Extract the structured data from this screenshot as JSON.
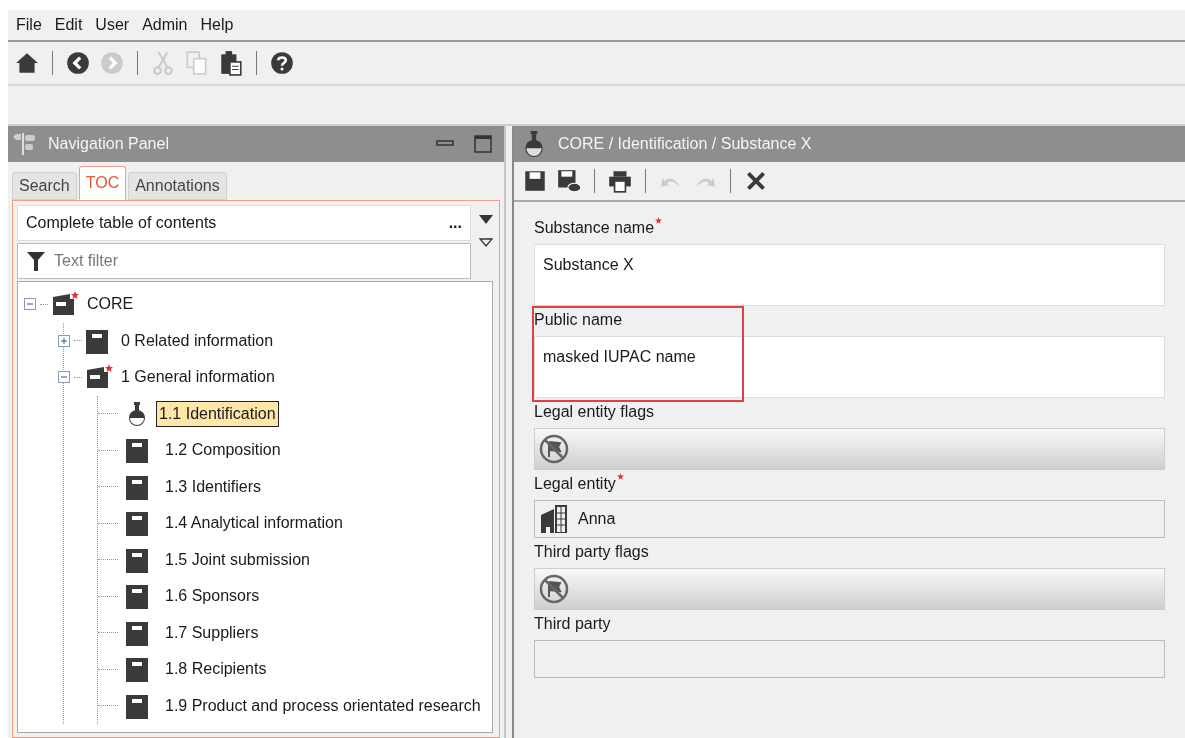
{
  "menu": [
    "File",
    "Edit",
    "User",
    "Admin",
    "Help"
  ],
  "toolbar": [
    {
      "kind": "home",
      "disabled": false
    },
    {
      "kind": "sep"
    },
    {
      "kind": "back",
      "disabled": false
    },
    {
      "kind": "forward",
      "disabled": true
    },
    {
      "kind": "sep"
    },
    {
      "kind": "cut",
      "disabled": true
    },
    {
      "kind": "copy",
      "disabled": true
    },
    {
      "kind": "paste",
      "disabled": false
    },
    {
      "kind": "sep"
    },
    {
      "kind": "help",
      "disabled": false
    }
  ],
  "navigation": {
    "title": "Navigation Panel",
    "tabs": [
      {
        "label": "Search",
        "selected": false
      },
      {
        "label": "TOC",
        "selected": true
      },
      {
        "label": "Annotations",
        "selected": false
      }
    ],
    "toc_selector": {
      "value": "Complete table of contents",
      "more": "..."
    },
    "filter": {
      "placeholder": "Text filter"
    },
    "tree": [
      {
        "label": "CORE",
        "kind": "folder",
        "required": true,
        "expanded": true,
        "selected": false,
        "children": [
          {
            "label": "0 Related information",
            "kind": "document",
            "required": false,
            "expanded": false,
            "selected": false
          },
          {
            "label": "1 General information",
            "kind": "folder",
            "required": true,
            "expanded": true,
            "selected": false,
            "children": [
              {
                "label": "1.1 Identification",
                "kind": "flask",
                "selected": true
              },
              {
                "label": "1.2 Composition",
                "kind": "document",
                "selected": false
              },
              {
                "label": "1.3 Identifiers",
                "kind": "document",
                "selected": false
              },
              {
                "label": "1.4 Analytical information",
                "kind": "document",
                "selected": false
              },
              {
                "label": "1.5 Joint submission",
                "kind": "document",
                "selected": false
              },
              {
                "label": "1.6 Sponsors",
                "kind": "document",
                "selected": false
              },
              {
                "label": "1.7 Suppliers",
                "kind": "document",
                "selected": false
              },
              {
                "label": "1.8 Recipients",
                "kind": "document",
                "selected": false
              },
              {
                "label": "1.9 Product and process orientated research",
                "kind": "document",
                "selected": false
              }
            ]
          }
        ]
      }
    ]
  },
  "document": {
    "title": "CORE / Identification / Substance X",
    "toolbar": [
      {
        "kind": "save",
        "disabled": false
      },
      {
        "kind": "save-comment",
        "disabled": false
      },
      {
        "kind": "sep"
      },
      {
        "kind": "print",
        "disabled": false
      },
      {
        "kind": "sep"
      },
      {
        "kind": "undo",
        "disabled": true
      },
      {
        "kind": "redo",
        "disabled": true
      },
      {
        "kind": "sep"
      },
      {
        "kind": "close",
        "disabled": false
      }
    ],
    "fields": [
      {
        "kind": "text",
        "label": "Substance name",
        "required": true,
        "highlighted": false,
        "value": "Substance X"
      },
      {
        "kind": "text",
        "label": "Public name",
        "required": false,
        "highlighted": true,
        "value": "masked IUPAC name"
      },
      {
        "kind": "flags",
        "label": "Legal entity flags",
        "required": false,
        "highlighted": false
      },
      {
        "kind": "entity",
        "label": "Legal entity",
        "required": true,
        "highlighted": false,
        "value": "Anna"
      },
      {
        "kind": "flags",
        "label": "Third party flags",
        "required": false,
        "highlighted": false
      },
      {
        "kind": "entity",
        "label": "Third party",
        "required": false,
        "highlighted": false
      }
    ]
  }
}
